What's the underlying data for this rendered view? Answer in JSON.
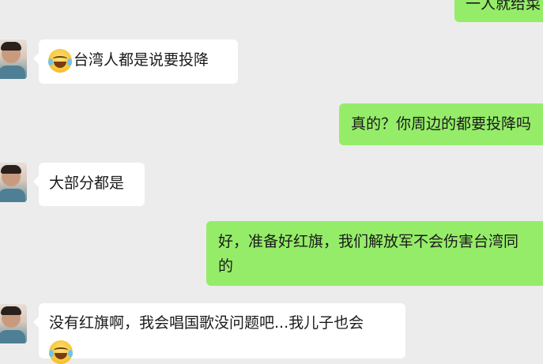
{
  "chat": {
    "messages": [
      {
        "side": "out",
        "text": "一人就给菜"
      },
      {
        "side": "in",
        "text": "台湾人都是说要投降",
        "emoji": "laughing-tears-icon"
      },
      {
        "side": "out",
        "text": "真的？你周边的都要投降吗"
      },
      {
        "side": "in",
        "text": "大部分都是"
      },
      {
        "side": "out",
        "lines": [
          "好，准备好红旗，我们解放军不会伤害台湾同",
          "的"
        ]
      },
      {
        "side": "in",
        "text": "没有红旗啊，我会唱国歌没问题吧...我儿子也会",
        "emoji": "laughing-tears-icon"
      }
    ]
  }
}
